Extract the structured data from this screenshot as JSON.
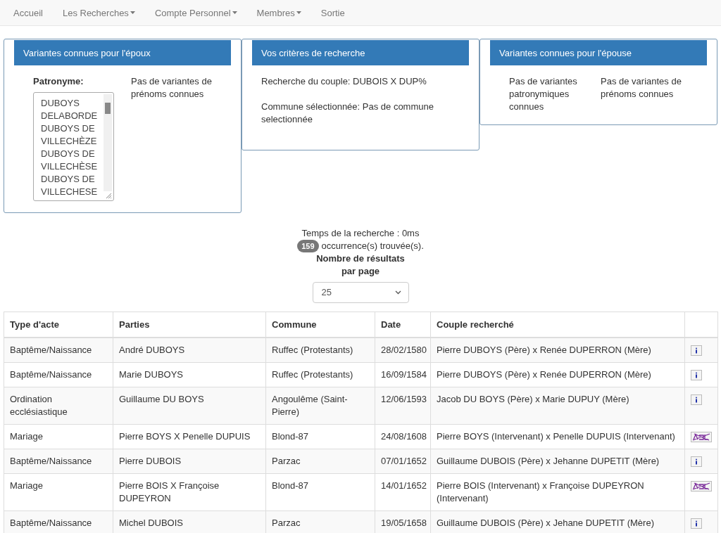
{
  "nav": [
    {
      "label": "Accueil",
      "dropdown": false
    },
    {
      "label": "Les Recherches",
      "dropdown": true
    },
    {
      "label": "Compte Personnel",
      "dropdown": true
    },
    {
      "label": "Membres",
      "dropdown": true
    },
    {
      "label": "Sortie",
      "dropdown": false
    }
  ],
  "panels": [
    {
      "title": "Variantes connues pour l'époux",
      "kind": "listbox",
      "list_label": "Patronyme:",
      "list_items": [
        "DUBOYS DELABORDE",
        "DUBOYS DE VILLECHÈZE",
        "DUBOYS DE VILLECHÈSE",
        "DUBOYS DE VILLECHESE"
      ],
      "note": "Pas de variantes de prénoms connues"
    },
    {
      "title": "Vos critères de recherche",
      "kind": "criteria",
      "lines": [
        "Recherche du couple: DUBOIS X DUP%",
        "Commune sélectionnée: Pas de commune selectionnée"
      ]
    },
    {
      "title": "Variantes connues pour l'épouse",
      "kind": "columns",
      "columns": [
        "Pas de variantes patronymiques connues",
        "Pas de variantes de prénoms connues"
      ]
    }
  ],
  "results": {
    "time": "Temps de la recherche : 0ms",
    "count": "159",
    "count_text": "occurrence(s) trouvée(s).",
    "per_page_label": "Nombre de résultats par page",
    "per_page": "25"
  },
  "table": {
    "columns": [
      "Type d'acte",
      "Parties",
      "Commune",
      "Date",
      "Couple recherché"
    ],
    "rows": [
      {
        "cells": [
          "Baptême/Naissance",
          "André DUBOYS",
          "Ruffec (Protestants)",
          "28/02/1580",
          "Pierre DUBOYS (Père) x Renée DUPERRON (Mère)"
        ],
        "kind": "info"
      },
      {
        "cells": [
          "Baptême/Naissance",
          "Marie DUBOYS",
          "Ruffec (Protestants)",
          "16/09/1584",
          "Pierre DUBOYS (Père) x Renée DUPERRON (Mère)"
        ],
        "kind": "info"
      },
      {
        "cells": [
          "Ordination ecclésiastique",
          "Guillaume DU BOYS",
          "Angoulême (Saint-Pierre)",
          "12/06/1593",
          "Jacob DU BOYS (Père) x Marie DUPUY (Mère)"
        ],
        "kind": "info"
      },
      {
        "cells": [
          "Mariage",
          "Pierre BOYS X Penelle DUPUIS",
          "Blond-87",
          "24/08/1608",
          "Pierre BOYS (Intervenant) x Penelle DUPUIS (Intervenant)"
        ],
        "kind": "crossed"
      },
      {
        "cells": [
          "Baptême/Naissance",
          "Pierre DUBOIS",
          "Parzac",
          "07/01/1652",
          "Guillaume DUBOIS (Père) x Jehanne DUPETIT (Mère)"
        ],
        "kind": "info"
      },
      {
        "cells": [
          "Mariage",
          "Pierre BOIS X Françoise DUPEYRON",
          "Blond-87",
          "14/01/1652",
          "Pierre BOIS (Intervenant) x Françoise DUPEYRON (Intervenant)"
        ],
        "kind": "crossed"
      },
      {
        "cells": [
          "Baptême/Naissance",
          "Michel DUBOIS",
          "Parzac",
          "19/05/1658",
          "Guillaume DUBOIS (Père) x Jehane DUPETIT (Mère)"
        ],
        "kind": "info"
      }
    ]
  }
}
